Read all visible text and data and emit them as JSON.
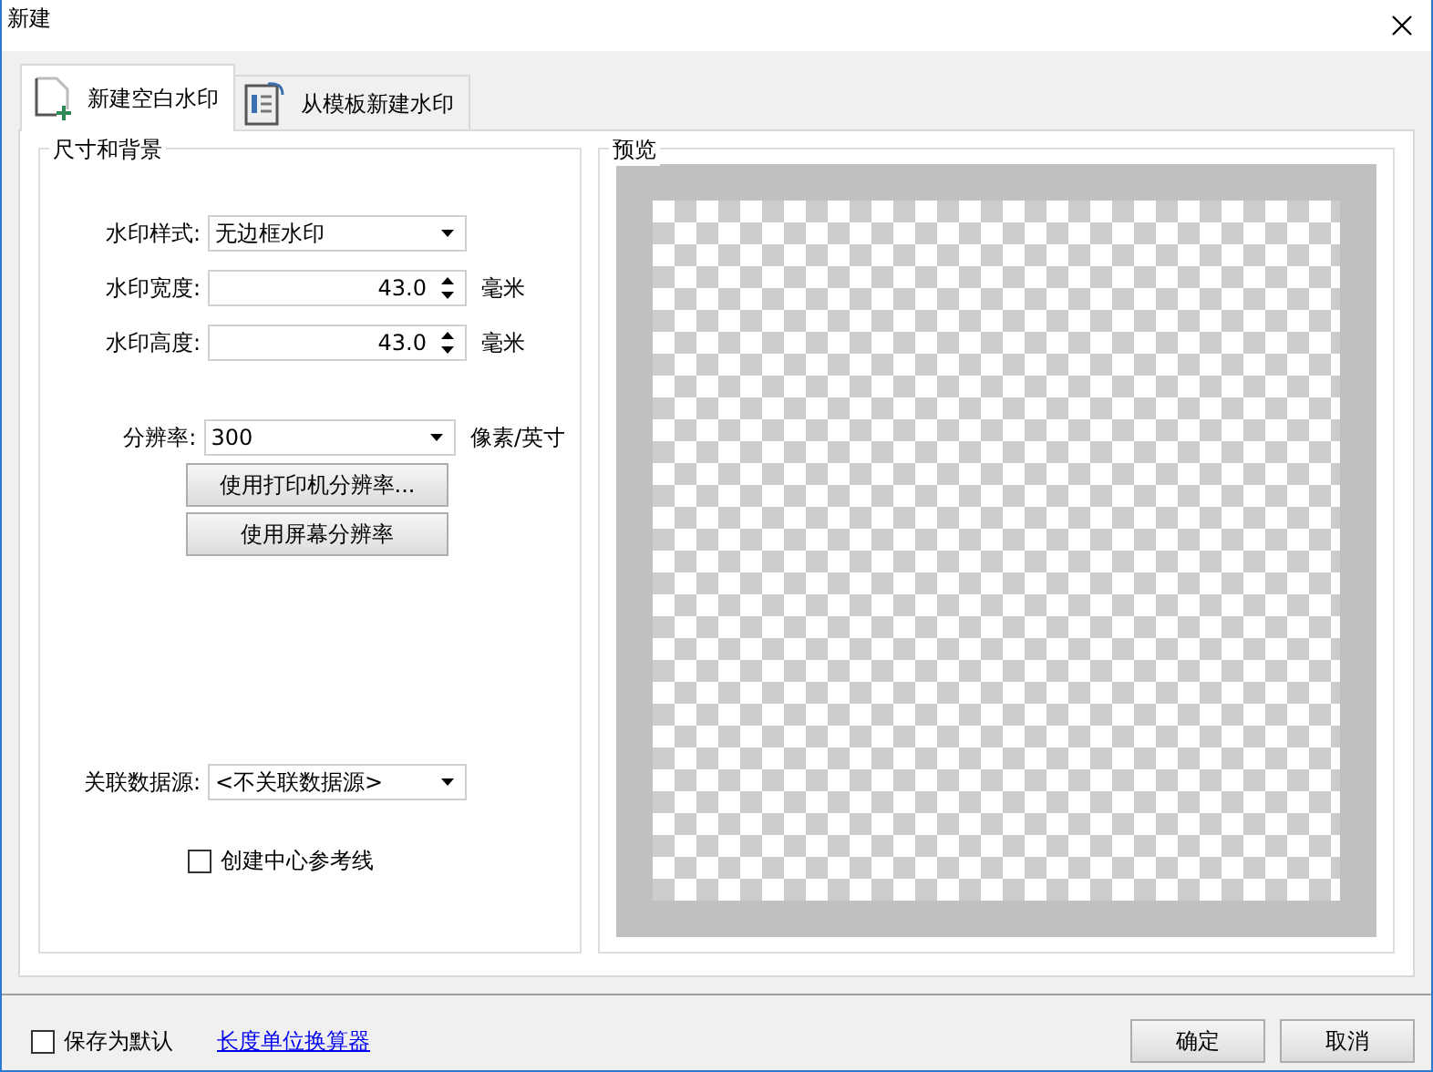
{
  "window": {
    "title": "新建"
  },
  "tabs": [
    {
      "label": "新建空白水印",
      "selected": true
    },
    {
      "label": "从模板新建水印",
      "selected": false
    }
  ],
  "size_group": {
    "title": "尺寸和背景",
    "fields": [
      {
        "kind": "select",
        "label": "水印样式:",
        "value": "无边框水印"
      },
      {
        "kind": "spin",
        "label": "水印宽度:",
        "value": "43.0",
        "unit": "毫米"
      },
      {
        "kind": "spin",
        "label": "水印高度:",
        "value": "43.0",
        "unit": "毫米"
      },
      {
        "kind": "gap"
      },
      {
        "kind": "select",
        "label": "分辨率:",
        "value": "300",
        "unit": "像素/英寸"
      }
    ],
    "buttons": [
      "使用打印机分辨率...",
      "使用屏幕分辨率"
    ],
    "data_source": {
      "label": "关联数据源:",
      "value": "<不关联数据源>"
    },
    "center_lines": {
      "label": "创建中心参考线",
      "checked": false
    }
  },
  "preview": {
    "title": "预览"
  },
  "footer": {
    "save_default": {
      "label": "保存为默认",
      "checked": false
    },
    "link": "长度单位换算器",
    "buttons": [
      "确定",
      "取消"
    ]
  }
}
